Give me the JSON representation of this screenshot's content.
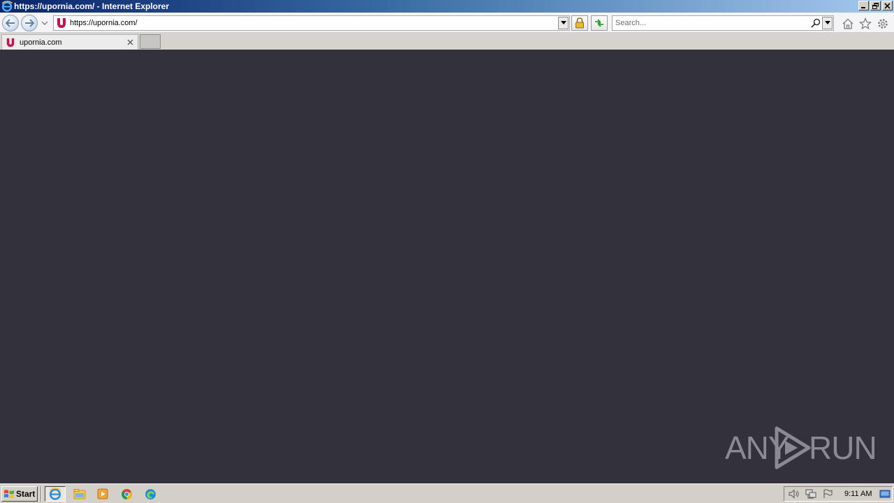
{
  "window": {
    "title": "https://upornia.com/ - Internet Explorer"
  },
  "navbar": {
    "url": "https://upornia.com/",
    "search_placeholder": "Search..."
  },
  "tabs": [
    {
      "title": "upornia.com",
      "active": true
    }
  ],
  "watermark": {
    "left": "ANY",
    "right": "RUN"
  },
  "taskbar": {
    "start_label": "Start",
    "apps": [
      {
        "icon": "internet-explorer-icon",
        "active": true
      },
      {
        "icon": "file-explorer-icon",
        "active": false
      },
      {
        "icon": "media-player-icon",
        "active": false
      },
      {
        "icon": "chrome-icon",
        "active": false
      },
      {
        "icon": "edge-icon",
        "active": false
      }
    ],
    "clock": "9:11 AM"
  },
  "colors": {
    "content_bg": "#33313b",
    "site_favicon": "#c8104a",
    "titlebar_start": "#0a246a",
    "titlebar_end": "#a6caf0"
  }
}
